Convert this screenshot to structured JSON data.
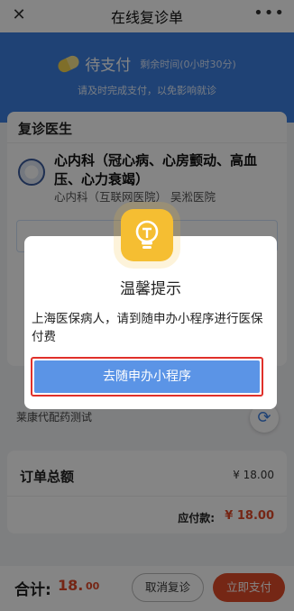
{
  "window": {
    "title": "在线复诊单",
    "close_icon": "close-icon",
    "more_icon": "more-icon"
  },
  "banner": {
    "status": "待支付",
    "remaining": "剩余时间(0小时30分)",
    "hint": "请及时完成支付，以免影响就诊"
  },
  "doctor_card": {
    "title": "复诊医生",
    "department": "心内科（冠心病、心房颤动、高血压、心力衰竭）",
    "hospital": "心内科（互联网医院） 吴淞医院",
    "drug_line": "莱康代配药测试"
  },
  "total_card": {
    "total_label": "订单总额",
    "total_value": "¥ 18.00",
    "pay_label": "应付款:",
    "pay_value": "¥ 18.00"
  },
  "bottom": {
    "sum_label": "合计:",
    "sum_value": "18.",
    "sum_cents": "00",
    "cancel_label": "取消复诊",
    "pay_label": "立即支付"
  },
  "modal": {
    "icon": "lightbulb-icon",
    "title": "温馨提示",
    "message": "上海医保病人，请到随申办小程序进行医保付费",
    "button_label": "去随申办小程序"
  },
  "colors": {
    "primary": "#3d7fe0",
    "accent": "#e04b2a",
    "modal_button": "#5b94e6",
    "highlight_border": "#e0302a",
    "bulb": "#f5be32"
  }
}
